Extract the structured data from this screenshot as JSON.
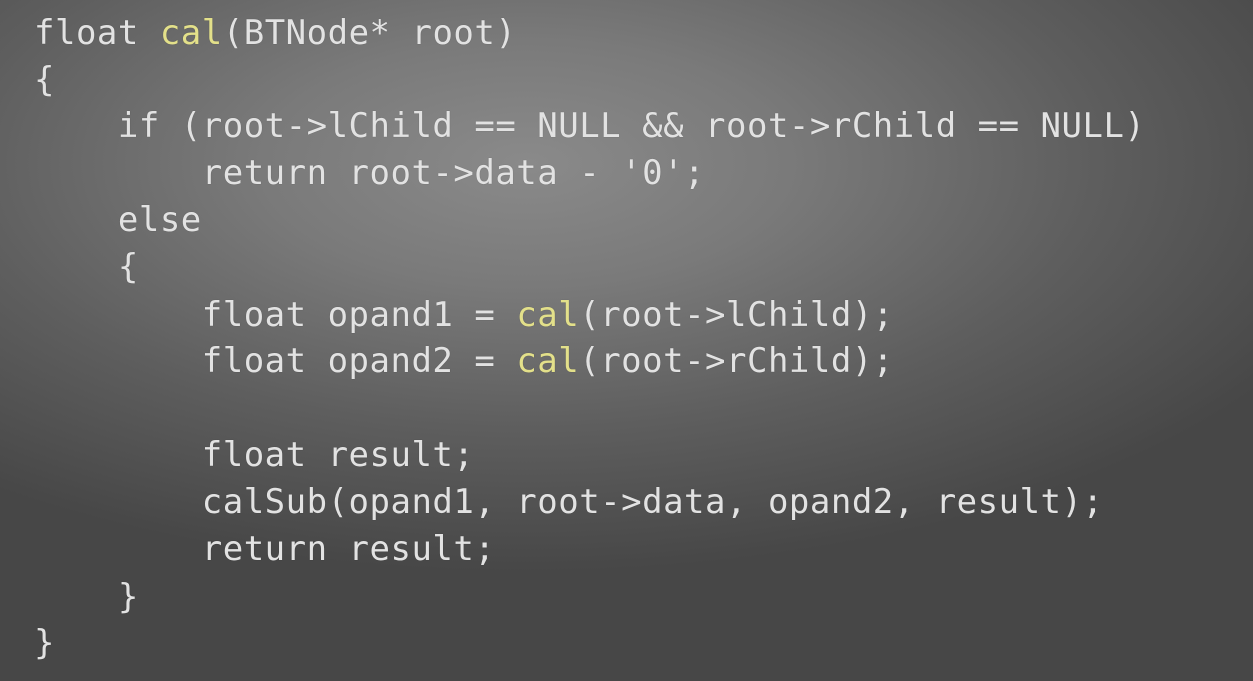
{
  "code": {
    "line1": {
      "a": "float ",
      "fn": "cal",
      "b": "(BTNode* root)"
    },
    "line2": "{",
    "line3": "    if (root->lChild == NULL && root->rChild == NULL)",
    "line4": "        return root->data - '0';",
    "line5": "    else",
    "line6": "    {",
    "line7": {
      "a": "        float opand1 = ",
      "fn": "cal",
      "b": "(root->lChild);"
    },
    "line8": {
      "a": "        float opand2 = ",
      "fn": "cal",
      "b": "(root->rChild);"
    },
    "line9": "        float result;",
    "line10": "        calSub(opand1, root->data, opand2, result);",
    "line11": "        return result;",
    "line12": "    }",
    "line13": "}"
  },
  "colors": {
    "text": "#e2e2e2",
    "function_name": "#e3e08a",
    "background": "#6a6a6a"
  }
}
